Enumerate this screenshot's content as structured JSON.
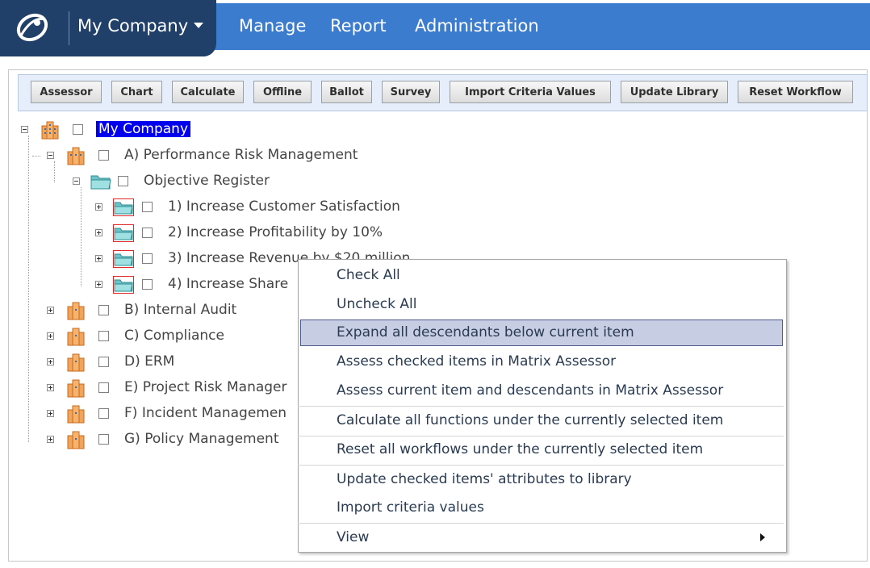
{
  "header": {
    "company": "My Company",
    "nav": [
      "Manage",
      "Report",
      "Administration"
    ]
  },
  "toolbar": {
    "buttons": [
      "Assessor",
      "Chart",
      "Calculate",
      "Offline",
      "Ballot",
      "Survey",
      "Import Criteria Values",
      "Update Library",
      "Reset Workflow"
    ]
  },
  "tree": {
    "root": "My Company",
    "items": [
      "A) Performance Risk Management",
      "Objective Register",
      "1) Increase Customer Satisfaction",
      "2) Increase Profitability by 10%",
      "3) Increase Revenue by $20 million",
      "4) Increase Share",
      "B) Internal Audit",
      "C) Compliance",
      "D) ERM",
      "E) Project Risk Manager",
      "F) Incident Managemen",
      "G) Policy Management"
    ]
  },
  "context_menu": {
    "items": [
      "Check All",
      "Uncheck All",
      "Expand all descendants below current item",
      "Assess checked items in Matrix Assessor",
      "Assess current item and descendants in Matrix Assessor",
      "Calculate all functions under the currently selected item",
      "Reset all workflows under the currently selected item",
      "Update checked items' attributes to library",
      "Import criteria values",
      "View"
    ],
    "highlighted": "Expand all descendants below current item"
  },
  "colors": {
    "nav_bar": "#3c7ccf",
    "brand_bg": "#20406a",
    "selection": "#0000ee",
    "menu_highlight": "#c7cde3"
  }
}
